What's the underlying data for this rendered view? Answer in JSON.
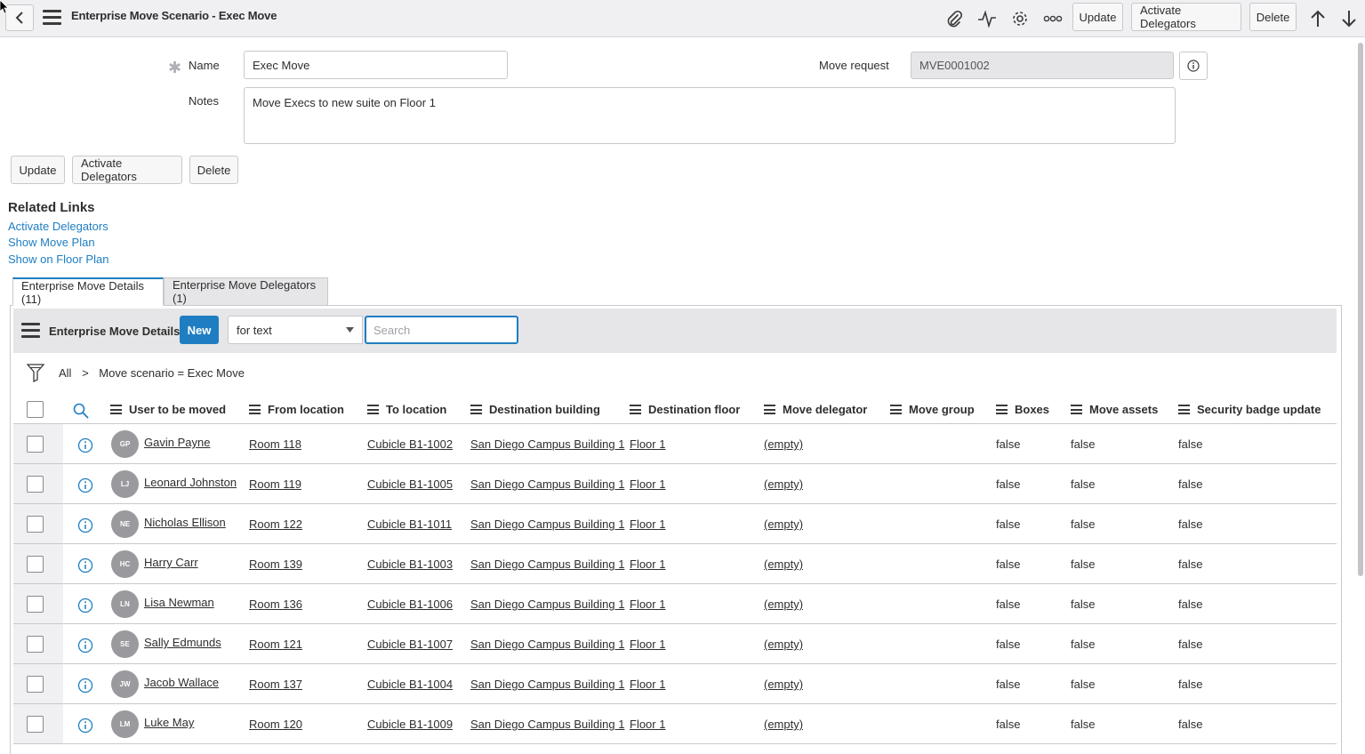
{
  "header": {
    "title": "Enterprise Move Scenario - Exec Move",
    "icons": [
      "back-icon",
      "menu-icon",
      "paperclip-icon",
      "activity-icon",
      "gear-icon",
      "more-icon",
      "arrow-up-icon",
      "arrow-down-icon"
    ],
    "buttons": {
      "update": "Update",
      "activate": "Activate Delegators",
      "delete": "Delete"
    }
  },
  "form": {
    "name_label": "Name",
    "name_value": "Exec Move",
    "move_request_label": "Move request",
    "move_request_value": "MVE0001002",
    "notes_label": "Notes",
    "notes_value": "Move Execs to new suite on Floor 1",
    "buttons": {
      "update": "Update",
      "activate": "Activate Delegators",
      "delete": "Delete"
    }
  },
  "related_links": {
    "title": "Related Links",
    "links": [
      "Activate Delegators",
      "Show Move Plan",
      "Show on Floor Plan"
    ]
  },
  "tabs": [
    "Enterprise Move Details (11)",
    "Enterprise Move Delegators (1)"
  ],
  "list": {
    "title": "Enterprise Move Details",
    "new_label": "New",
    "search_field": "for text",
    "search_placeholder": "Search",
    "breadcrumb": {
      "all": "All",
      "sep": ">",
      "filter": "Move scenario = Exec Move"
    },
    "columns": [
      "User to be moved",
      "From location",
      "To location",
      "Destination building",
      "Destination floor",
      "Move delegator",
      "Move group",
      "Boxes",
      "Move assets",
      "Security badge update"
    ],
    "rows": [
      {
        "initials": "GP",
        "user": "Gavin Payne",
        "from": "Room 118",
        "to": "Cubicle B1-1002",
        "building": "San Diego Campus Building 1",
        "floor": "Floor 1",
        "delegator": "(empty)",
        "group": "",
        "boxes": "false",
        "assets": "false",
        "badge": "false"
      },
      {
        "initials": "LJ",
        "user": "Leonard Johnston",
        "from": "Room 119",
        "to": "Cubicle B1-1005",
        "building": "San Diego Campus Building 1",
        "floor": "Floor 1",
        "delegator": "(empty)",
        "group": "",
        "boxes": "false",
        "assets": "false",
        "badge": "false"
      },
      {
        "initials": "NE",
        "user": "Nicholas Ellison",
        "from": "Room 122",
        "to": "Cubicle B1-1011",
        "building": "San Diego Campus Building 1",
        "floor": "Floor 1",
        "delegator": "(empty)",
        "group": "",
        "boxes": "false",
        "assets": "false",
        "badge": "false"
      },
      {
        "initials": "HC",
        "user": "Harry Carr",
        "from": "Room 139",
        "to": "Cubicle B1-1003",
        "building": "San Diego Campus Building 1",
        "floor": "Floor 1",
        "delegator": "(empty)",
        "group": "",
        "boxes": "false",
        "assets": "false",
        "badge": "false"
      },
      {
        "initials": "LN",
        "user": "Lisa Newman",
        "from": "Room 136",
        "to": "Cubicle B1-1006",
        "building": "San Diego Campus Building 1",
        "floor": "Floor 1",
        "delegator": "(empty)",
        "group": "",
        "boxes": "false",
        "assets": "false",
        "badge": "false"
      },
      {
        "initials": "SE",
        "user": "Sally Edmunds",
        "from": "Room 121",
        "to": "Cubicle B1-1007",
        "building": "San Diego Campus Building 1",
        "floor": "Floor 1",
        "delegator": "(empty)",
        "group": "",
        "boxes": "false",
        "assets": "false",
        "badge": "false"
      },
      {
        "initials": "JW",
        "user": "Jacob Wallace",
        "from": "Room 137",
        "to": "Cubicle B1-1004",
        "building": "San Diego Campus Building 1",
        "floor": "Floor 1",
        "delegator": "(empty)",
        "group": "",
        "boxes": "false",
        "assets": "false",
        "badge": "false"
      },
      {
        "initials": "LM",
        "user": "Luke May",
        "from": "Room 120",
        "to": "Cubicle B1-1009",
        "building": "San Diego Campus Building 1",
        "floor": "Floor 1",
        "delegator": "(empty)",
        "group": "",
        "boxes": "false",
        "assets": "false",
        "badge": "false"
      }
    ]
  },
  "colors": {
    "accent": "#1f7ec2",
    "header_bg": "#f0f0f2",
    "toolbar_bg": "#e6e6e8",
    "avatar_bg": "#9a9a9e"
  }
}
